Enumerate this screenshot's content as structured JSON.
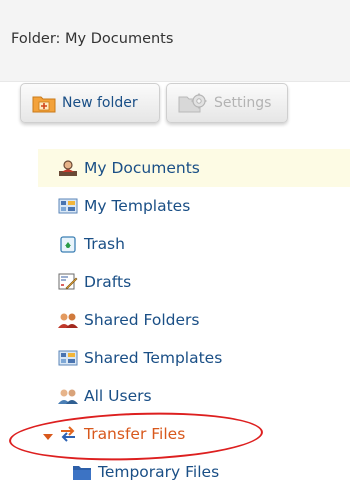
{
  "header": {
    "title": "Folder: My Documents"
  },
  "toolbar": {
    "new_folder_label": "New folder",
    "settings_label": "Settings"
  },
  "tree": {
    "items": [
      {
        "label": "My Documents",
        "icon": "user-folder-icon",
        "selected": true
      },
      {
        "label": "My Templates",
        "icon": "templates-icon"
      },
      {
        "label": "Trash",
        "icon": "trash-icon"
      },
      {
        "label": "Drafts",
        "icon": "drafts-icon"
      },
      {
        "label": "Shared Folders",
        "icon": "shared-folders-icon"
      },
      {
        "label": "Shared Templates",
        "icon": "shared-templates-icon"
      },
      {
        "label": "All Users",
        "icon": "all-users-icon"
      },
      {
        "label": "Transfer Files",
        "icon": "transfer-icon",
        "expanded": true
      },
      {
        "label": "Temporary Files",
        "icon": "folder-icon"
      }
    ]
  },
  "colors": {
    "link": "#1a4f86",
    "transfer": "#d8581c",
    "annotation": "#dd1f1f",
    "selected_bg": "#fdfbe4"
  }
}
